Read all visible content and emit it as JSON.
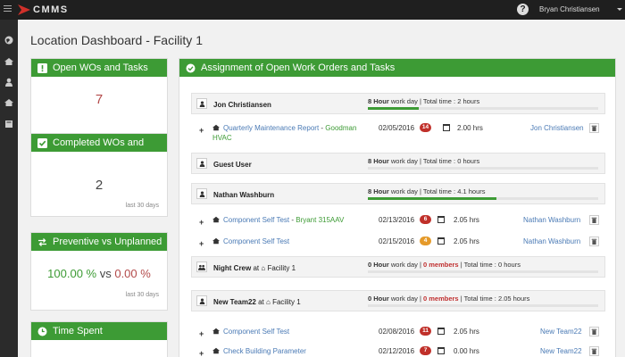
{
  "app": {
    "brand": "CMMS",
    "user": "Bryan Christiansen"
  },
  "page": {
    "title": "Location Dashboard - Facility 1"
  },
  "widgets": {
    "open_wos": {
      "title": "Open WOs and Tasks",
      "value": "7"
    },
    "completed_wos": {
      "title": "Completed WOs and",
      "value": "2",
      "note": "last 30 days"
    },
    "preventive": {
      "title": "Preventive vs Unplanned",
      "preventive_value": "100.00 %",
      "vs": "vs",
      "unplanned_value": "0.00 %",
      "note": "last 30 days"
    },
    "time_spent": {
      "title": "Time Spent"
    }
  },
  "assignment": {
    "title": "Assignment of Open Work Orders and Tasks",
    "groups": [
      {
        "name": "Jon Christiansen",
        "hours": "8 Hour",
        "workday": "work day",
        "total": "| Total time : 2 hours",
        "progress": 0.22
      },
      {
        "name": "Guest User",
        "hours": "8 Hour",
        "workday": "work day",
        "total": "| Total time : 0 hours",
        "progress": 0
      },
      {
        "name": "Nathan Washburn",
        "hours": "8 Hour",
        "workday": "work day",
        "total": "| Total time : 4.1 hours",
        "progress": 0.56
      },
      {
        "name": "Night Crew",
        "at": "at",
        "location": "Facility 1",
        "hours": "0 Hour",
        "workday": "work day |",
        "members": "0 members",
        "total": "| Total time : 0 hours",
        "progress": 0
      },
      {
        "name": "New Team22",
        "at": "at",
        "location": "Facility 1",
        "hours": "0 Hour",
        "workday": "work day |",
        "members": "0 members",
        "total": "| Total time : 2.05 hours",
        "progress": 0
      }
    ],
    "tasks": [
      {
        "name": "Quarterly Maintenance Report",
        "sep": " - ",
        "asset": "Goodman",
        "asset_line2": "HVAC",
        "date": "02/05/2016",
        "badge": "14",
        "hrs": "2.00 hrs",
        "assignee": "Jon Christiansen"
      },
      {
        "name": "Component Self Test",
        "sep": " - ",
        "asset": "Bryant 315AAV",
        "date": "02/13/2016",
        "badge": "6",
        "hrs": "2.05 hrs",
        "assignee": "Nathan Washburn"
      },
      {
        "name": "Component Self Test",
        "date": "02/15/2016",
        "badge": "4",
        "hrs": "2.05 hrs",
        "assignee": "Nathan Washburn"
      },
      {
        "name": "Component Self Test",
        "date": "02/08/2016",
        "badge": "11",
        "hrs": "2.05 hrs",
        "assignee": "New Team22"
      },
      {
        "name": "Check Building Parameter",
        "date": "02/12/2016",
        "badge": "7",
        "hrs": "0.00 hrs",
        "assignee": "New Team22"
      }
    ]
  },
  "colors": {
    "accent_green": "#3d9b35",
    "topbar": "#1f1f1f",
    "sidebar": "#2b2b2b",
    "badge_red": "#c0302a",
    "badge_orange": "#e59a2a",
    "link_blue": "#4a7ab5"
  }
}
